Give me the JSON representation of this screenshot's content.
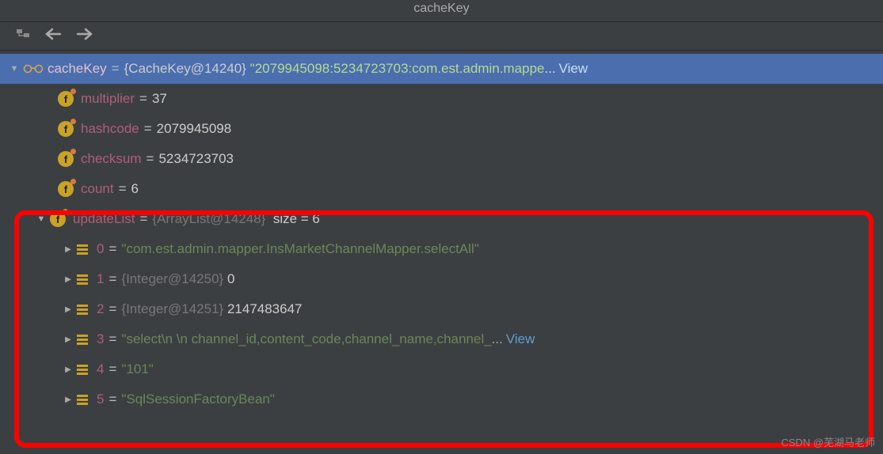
{
  "header": {
    "title": "cacheKey"
  },
  "root": {
    "name": "cacheKey",
    "eq": " = ",
    "objRef": "{CacheKey@14240}",
    "strVal": "\"2079945098:5234723703:com.est.admin.mappe",
    "dots": "...",
    "view": "View"
  },
  "fields": {
    "multiplier": {
      "name": "multiplier",
      "val": "37"
    },
    "hashcode": {
      "name": "hashcode",
      "val": "2079945098"
    },
    "checksum": {
      "name": "checksum",
      "val": "5234723703"
    },
    "count": {
      "name": "count",
      "val": "6"
    },
    "updateList": {
      "name": "updateList",
      "objRef": "{ArrayList@14248}",
      "size": "size = 6"
    }
  },
  "items": {
    "i0": {
      "idx": "0",
      "val": "\"com.est.admin.mapper.InsMarketChannelMapper.selectAll\""
    },
    "i1": {
      "idx": "1",
      "objRef": "{Integer@14250}",
      "val": "0"
    },
    "i2": {
      "idx": "2",
      "objRef": "{Integer@14251}",
      "val": "2147483647"
    },
    "i3": {
      "idx": "3",
      "val": "\"select\\n        \\n        channel_id,content_code,channel_name,channel_",
      "dots": "...",
      "view": "View"
    },
    "i4": {
      "idx": "4",
      "val": "\"101\""
    },
    "i5": {
      "idx": "5",
      "val": "\"SqlSessionFactoryBean\""
    }
  },
  "watermark": "CSDN @芜湖马老师"
}
